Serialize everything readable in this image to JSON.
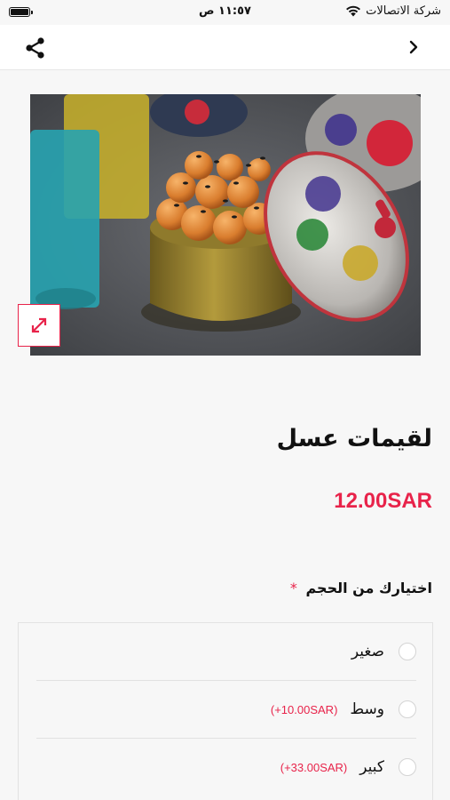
{
  "status_bar": {
    "carrier": "شركة الاتصالات",
    "time": "١١:٥٧ ص"
  },
  "nav": {
    "back_icon": "chevron-right-icon",
    "share_icon": "share-icon"
  },
  "product": {
    "image_alt_icon": "product-photo",
    "expand_icon": "expand-arrows-icon",
    "title": "لقيمات عسل",
    "price": "12.00SAR"
  },
  "options": {
    "label": "اختيارك من الحجم",
    "required": "*",
    "items": [
      {
        "name": "صغير",
        "extra": ""
      },
      {
        "name": "وسط",
        "extra": "(+10.00SAR)"
      },
      {
        "name": "كبير",
        "extra": "(+33.00SAR)"
      }
    ]
  },
  "colors": {
    "accent": "#e8234a",
    "background": "#f7f7f7",
    "border": "#e2e2e2"
  }
}
